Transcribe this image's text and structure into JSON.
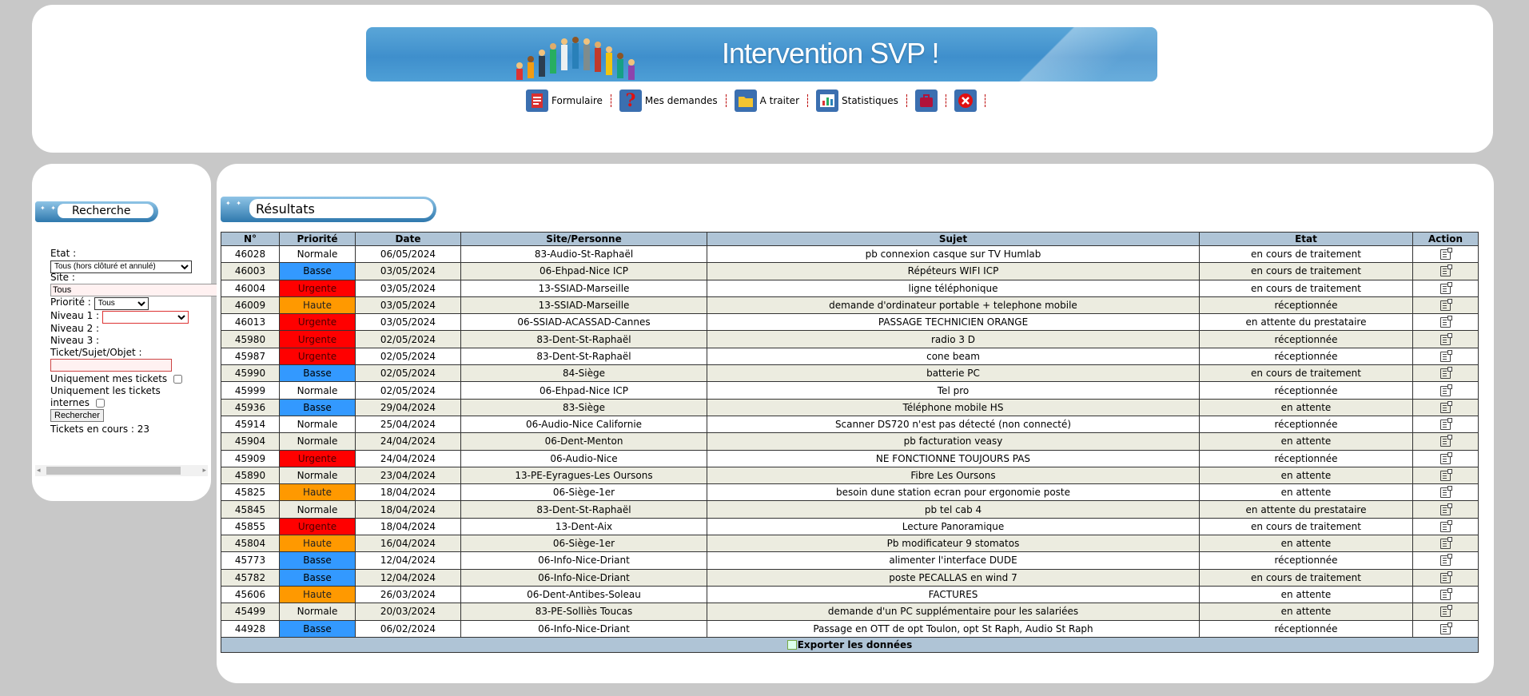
{
  "banner": {
    "title": "Intervention SVP !"
  },
  "menu": [
    {
      "label": "Formulaire",
      "icon": "form-icon"
    },
    {
      "label": "Mes demandes",
      "icon": "question-icon"
    },
    {
      "label": "A traiter",
      "icon": "folder-icon"
    },
    {
      "label": "Statistiques",
      "icon": "chart-icon"
    },
    {
      "label": "",
      "icon": "briefcase-icon"
    },
    {
      "label": "",
      "icon": "close-icon"
    }
  ],
  "search": {
    "heading": "Recherche",
    "etat_label": "Etat :",
    "etat_value": "Tous (hors clôturé et annulé)",
    "site_label": "Site :",
    "site_value": "Tous",
    "priorite_label": "Priorité :",
    "priorite_value": "Tous",
    "niveau1_label": "Niveau 1 :",
    "niveau1_value": "",
    "niveau2_label": "Niveau 2 :",
    "niveau3_label": "Niveau 3 :",
    "ticket_label": "Ticket/Sujet/Objet :",
    "ticket_value": "",
    "mes_tickets_label": "Uniquement mes tickets",
    "internes_label_1": "Uniquement les tickets",
    "internes_label_2": "internes",
    "submit_label": "Rechercher",
    "count_text": "Tickets en cours : 23"
  },
  "results": {
    "heading": "Résultats",
    "columns": [
      "N°",
      "Priorité",
      "Date",
      "Site/Personne",
      "Sujet",
      "Etat",
      "Action"
    ],
    "rows": [
      [
        "46028",
        "Normale",
        "06/05/2024",
        "83-Audio-St-Raphaël",
        "pb connexion casque sur TV Humlab",
        "en cours de traitement"
      ],
      [
        "46003",
        "Basse",
        "03/05/2024",
        "06-Ehpad-Nice ICP",
        "Répéteurs WIFI ICP",
        "en cours de traitement"
      ],
      [
        "46004",
        "Urgente",
        "03/05/2024",
        "13-SSIAD-Marseille",
        "ligne téléphonique",
        "en cours de traitement"
      ],
      [
        "46009",
        "Haute",
        "03/05/2024",
        "13-SSIAD-Marseille",
        "demande d'ordinateur portable + telephone mobile",
        "réceptionnée"
      ],
      [
        "46013",
        "Urgente",
        "03/05/2024",
        "06-SSIAD-ACASSAD-Cannes",
        "PASSAGE TECHNICIEN ORANGE",
        "en attente du prestataire"
      ],
      [
        "45980",
        "Urgente",
        "02/05/2024",
        "83-Dent-St-Raphaël",
        "radio 3 D",
        "réceptionnée"
      ],
      [
        "45987",
        "Urgente",
        "02/05/2024",
        "83-Dent-St-Raphaël",
        "cone beam",
        "réceptionnée"
      ],
      [
        "45990",
        "Basse",
        "02/05/2024",
        "84-Siège",
        "batterie PC",
        "en cours de traitement"
      ],
      [
        "45999",
        "Normale",
        "02/05/2024",
        "06-Ehpad-Nice ICP",
        "Tel pro",
        "réceptionnée"
      ],
      [
        "45936",
        "Basse",
        "29/04/2024",
        "83-Siège",
        "Téléphone mobile HS",
        "en attente"
      ],
      [
        "45914",
        "Normale",
        "25/04/2024",
        "06-Audio-Nice Californie",
        "Scanner DS720 n'est pas détecté (non connecté)",
        "réceptionnée"
      ],
      [
        "45904",
        "Normale",
        "24/04/2024",
        "06-Dent-Menton",
        "pb facturation veasy",
        "en attente"
      ],
      [
        "45909",
        "Urgente",
        "24/04/2024",
        "06-Audio-Nice",
        "NE FONCTIONNE TOUJOURS PAS",
        "réceptionnée"
      ],
      [
        "45890",
        "Normale",
        "23/04/2024",
        "13-PE-Eyragues-Les Oursons",
        "Fibre Les Oursons",
        "en attente"
      ],
      [
        "45825",
        "Haute",
        "18/04/2024",
        "06-Siège-1er",
        "besoin dune station ecran pour ergonomie poste",
        "en attente"
      ],
      [
        "45845",
        "Normale",
        "18/04/2024",
        "83-Dent-St-Raphaël",
        "pb tel cab 4",
        "en attente du prestataire"
      ],
      [
        "45855",
        "Urgente",
        "18/04/2024",
        "13-Dent-Aix",
        "Lecture Panoramique",
        "en cours de traitement"
      ],
      [
        "45804",
        "Haute",
        "16/04/2024",
        "06-Siège-1er",
        "Pb modificateur 9 stomatos",
        "en attente"
      ],
      [
        "45773",
        "Basse",
        "12/04/2024",
        "06-Info-Nice-Driant",
        "alimenter l'interface DUDE",
        "réceptionnée"
      ],
      [
        "45782",
        "Basse",
        "12/04/2024",
        "06-Info-Nice-Driant",
        "poste PECALLAS en wind 7",
        "en cours de traitement"
      ],
      [
        "45606",
        "Haute",
        "26/03/2024",
        "06-Dent-Antibes-Soleau",
        "FACTURES",
        "en attente"
      ],
      [
        "45499",
        "Normale",
        "20/03/2024",
        "83-PE-Solliès Toucas",
        "demande d'un PC supplémentaire pour les salariées",
        "en attente"
      ],
      [
        "44928",
        "Basse",
        "06/02/2024",
        "06-Info-Nice-Driant",
        "Passage en OTT de opt Toulon, opt St Raph, Audio St Raph",
        "réceptionnée"
      ]
    ],
    "export_label": "Exporter les données"
  },
  "colors": {
    "urgente": "#ff0000",
    "haute": "#ff9900",
    "basse": "#3399ff",
    "header_bg": "#afc4d6",
    "row_alt": "#ecece0"
  }
}
